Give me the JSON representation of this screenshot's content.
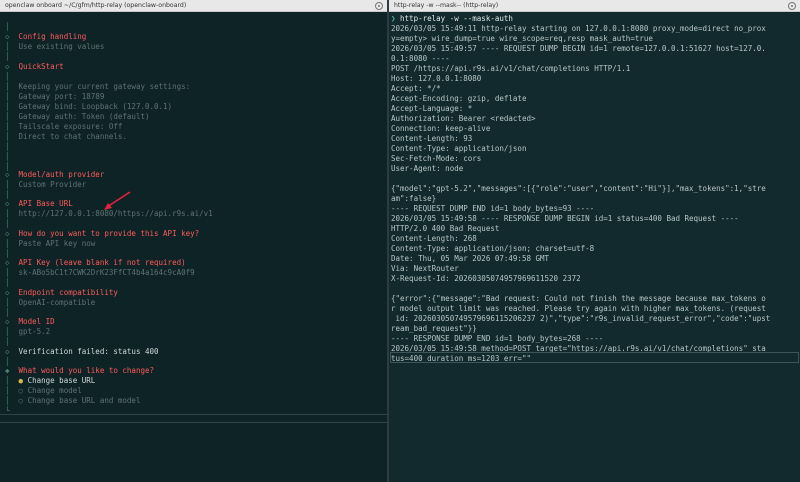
{
  "left_pane": {
    "title": "openclaw onboard ~/C/gfm/http-relay (openclaw-onboard)",
    "lines": {
      "config_title": "Config handling",
      "config_value": "Use existing values",
      "quickstart_title": "QuickStart",
      "qs_line1": "Keeping your current gateway settings:",
      "qs_line2": "Gateway port: 18789",
      "qs_line3": "Gateway bind: Loopback (127.0.0.1)",
      "qs_line4": "Gateway auth: Token (default)",
      "qs_line5": "Tailscale exposure: Off",
      "qs_line6": "Direct to chat channels.",
      "provider_title": "Model/auth provider",
      "provider_value": "Custom Provider",
      "baseurl_title": "API Base URL",
      "baseurl_value": "http://127.0.0.1:8080/https://api.r9s.ai/v1",
      "howkey_title": "How do you want to provide this API key?",
      "howkey_value": "Paste API key now",
      "apikey_title": "API Key (leave blank if not required)",
      "apikey_value": "sk-ABo5bC1t7CWK2DrK23FfCT4b4a164c9cA0f9",
      "endpoint_title": "Endpoint compatibility",
      "endpoint_value": "OpenAI-compatible",
      "modelid_title": "Model ID",
      "modelid_value": "gpt-5.2",
      "verification": "Verification failed: status 400",
      "change_title": "What would you like to change?",
      "opt1": "Change base URL",
      "opt2": "Change model",
      "opt3": "Change base URL and model"
    },
    "symbols": {
      "step": "◇",
      "active": "◆",
      "rail": "│",
      "radio_on": "●",
      "radio_off": "○"
    }
  },
  "right_pane": {
    "title": "http-relay -w --mask-- (http-relay)",
    "prompt_symbol": "❯",
    "command": "http-relay -w --mask-auth",
    "lines": [
      "2026/03/05 15:49:11 http-relay starting on 127.0.0.1:8080 proxy_mode=direct no_prox",
      "y=empty> wire_dump=true wire_scope=req,resp mask_auth=true",
      "2026/03/05 15:49:57 ---- REQUEST DUMP BEGIN id=1 remote=127.0.0.1:51627 host=127.0.",
      "0.1:8080 ----",
      "POST /https://api.r9s.ai/v1/chat/completions HTTP/1.1",
      "Host: 127.0.0.1:8080",
      "Accept: */*",
      "Accept-Encoding: gzip, deflate",
      "Accept-Language: *",
      "Authorization: Bearer <redacted>",
      "Connection: keep-alive",
      "Content-Length: 93",
      "Content-Type: application/json",
      "Sec-Fetch-Mode: cors",
      "User-Agent: node",
      "",
      "{\"model\":\"gpt-5.2\",\"messages\":[{\"role\":\"user\",\"content\":\"Hi\"}],\"max_tokens\":1,\"stre",
      "am\":false}",
      "---- REQUEST DUMP END id=1 body_bytes=93 ----",
      "2026/03/05 15:49:58 ---- RESPONSE DUMP BEGIN id=1 status=400 Bad Request ----",
      "HTTP/2.0 400 Bad Request",
      "Content-Length: 268",
      "Content-Type: application/json; charset=utf-8",
      "Date: Thu, 05 Mar 2026 07:49:58 GMT",
      "Via: NextRouter",
      "X-Request-Id: 20260305074957969611520 2372",
      "",
      "{\"error\":{\"message\":\"Bad request: Could not finish the message because max_tokens o",
      "r model output limit was reached. Please try again with higher max_tokens. (request",
      " id: 202603050749579696115206237 2)\",\"type\":\"r9s_invalid_request_error\",\"code\":\"upst",
      "ream_bad_request\"}}",
      "---- RESPONSE DUMP END id=1 body_bytes=268 ----",
      "2026/03/05 15:49:58 method=POST target=\"https://api.r9s.ai/v1/chat/completions\" sta",
      "tus=400 duration_ms=1203 err=\"\""
    ]
  },
  "colors": {
    "left_bg": "#0e2326",
    "right_bg": "#122a2d",
    "heading_red": "#ff5a5a",
    "dim_text": "#5f7376",
    "annotation_arrow": "#e2233a"
  }
}
